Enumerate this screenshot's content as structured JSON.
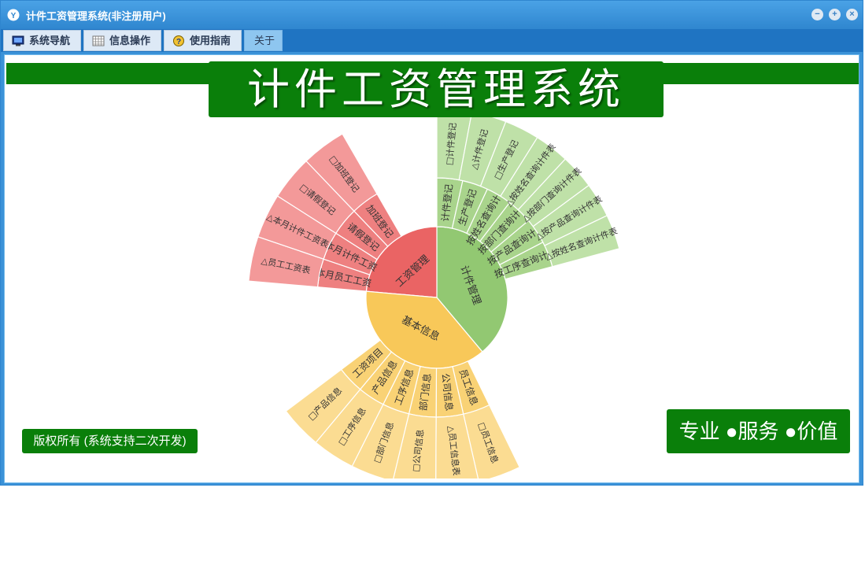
{
  "window": {
    "title": "计件工资管理系统(非注册用户)",
    "minimize_glyph": "−",
    "restore_glyph": "+",
    "close_glyph": "×"
  },
  "menu": {
    "items": [
      {
        "label": "系统导航",
        "icon": "monitor-icon"
      },
      {
        "label": "信息操作",
        "icon": "grid-icon"
      },
      {
        "label": "使用指南",
        "icon": "help-icon"
      },
      {
        "label": "关于",
        "icon": ""
      }
    ]
  },
  "banner": {
    "title": "计件工资管理系统"
  },
  "footer": {
    "copyright": "版权所有 (系统支持二次开发)",
    "slogan": "专业 ●服务 ●价值"
  },
  "colors": {
    "piece": [
      "#92c872",
      "#a9d48c",
      "#bfe1a8"
    ],
    "salary": [
      "#ea6464",
      "#ee8080",
      "#f39999"
    ],
    "basic": [
      "#f8c859",
      "#f9d275",
      "#fbdc92"
    ]
  },
  "sunburst": {
    "groups": [
      {
        "key": "piece",
        "label": "计件管理",
        "ring2": [
          "计件登记",
          "生产登记",
          "按姓名查询计件",
          "按部门查询计件",
          "按产品查询计件",
          "按工序查询计件"
        ],
        "ring3": [
          "□计件登记",
          "△计件登记",
          "□生产登记",
          "△按姓名查询计件表",
          "△按部门查询计件表",
          "△按产品查询计件表",
          "△按姓名查询计件表"
        ]
      },
      {
        "key": "salary",
        "label": "工资管理",
        "ring2": [
          "本月员工工资",
          "本月计件工资",
          "请假登记",
          "加班登记"
        ],
        "ring3": [
          "△员工工资表",
          "△本月计件工资表",
          "□请假登记",
          "□加班登记"
        ]
      },
      {
        "key": "basic",
        "label": "基本信息",
        "ring2": [
          "员工信息",
          "公司信息",
          "部门信息",
          "工序信息",
          "产品信息",
          "工资项目"
        ],
        "ring3": [
          "□员工信息",
          "△员工信息表",
          "□公司信息",
          "□部门信息",
          "□工序信息",
          "□产品信息"
        ]
      }
    ]
  }
}
